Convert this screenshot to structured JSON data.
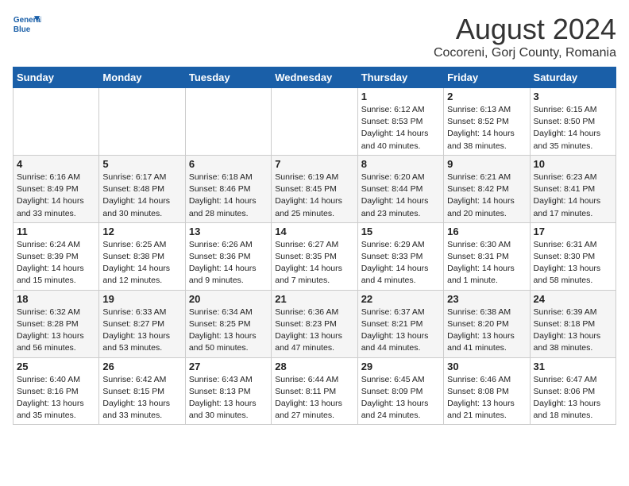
{
  "header": {
    "logo_line1": "General",
    "logo_line2": "Blue",
    "month_year": "August 2024",
    "location": "Cocoreni, Gorj County, Romania"
  },
  "weekdays": [
    "Sunday",
    "Monday",
    "Tuesday",
    "Wednesday",
    "Thursday",
    "Friday",
    "Saturday"
  ],
  "weeks": [
    [
      {
        "day": "",
        "info": ""
      },
      {
        "day": "",
        "info": ""
      },
      {
        "day": "",
        "info": ""
      },
      {
        "day": "",
        "info": ""
      },
      {
        "day": "1",
        "info": "Sunrise: 6:12 AM\nSunset: 8:53 PM\nDaylight: 14 hours\nand 40 minutes."
      },
      {
        "day": "2",
        "info": "Sunrise: 6:13 AM\nSunset: 8:52 PM\nDaylight: 14 hours\nand 38 minutes."
      },
      {
        "day": "3",
        "info": "Sunrise: 6:15 AM\nSunset: 8:50 PM\nDaylight: 14 hours\nand 35 minutes."
      }
    ],
    [
      {
        "day": "4",
        "info": "Sunrise: 6:16 AM\nSunset: 8:49 PM\nDaylight: 14 hours\nand 33 minutes."
      },
      {
        "day": "5",
        "info": "Sunrise: 6:17 AM\nSunset: 8:48 PM\nDaylight: 14 hours\nand 30 minutes."
      },
      {
        "day": "6",
        "info": "Sunrise: 6:18 AM\nSunset: 8:46 PM\nDaylight: 14 hours\nand 28 minutes."
      },
      {
        "day": "7",
        "info": "Sunrise: 6:19 AM\nSunset: 8:45 PM\nDaylight: 14 hours\nand 25 minutes."
      },
      {
        "day": "8",
        "info": "Sunrise: 6:20 AM\nSunset: 8:44 PM\nDaylight: 14 hours\nand 23 minutes."
      },
      {
        "day": "9",
        "info": "Sunrise: 6:21 AM\nSunset: 8:42 PM\nDaylight: 14 hours\nand 20 minutes."
      },
      {
        "day": "10",
        "info": "Sunrise: 6:23 AM\nSunset: 8:41 PM\nDaylight: 14 hours\nand 17 minutes."
      }
    ],
    [
      {
        "day": "11",
        "info": "Sunrise: 6:24 AM\nSunset: 8:39 PM\nDaylight: 14 hours\nand 15 minutes."
      },
      {
        "day": "12",
        "info": "Sunrise: 6:25 AM\nSunset: 8:38 PM\nDaylight: 14 hours\nand 12 minutes."
      },
      {
        "day": "13",
        "info": "Sunrise: 6:26 AM\nSunset: 8:36 PM\nDaylight: 14 hours\nand 9 minutes."
      },
      {
        "day": "14",
        "info": "Sunrise: 6:27 AM\nSunset: 8:35 PM\nDaylight: 14 hours\nand 7 minutes."
      },
      {
        "day": "15",
        "info": "Sunrise: 6:29 AM\nSunset: 8:33 PM\nDaylight: 14 hours\nand 4 minutes."
      },
      {
        "day": "16",
        "info": "Sunrise: 6:30 AM\nSunset: 8:31 PM\nDaylight: 14 hours\nand 1 minute."
      },
      {
        "day": "17",
        "info": "Sunrise: 6:31 AM\nSunset: 8:30 PM\nDaylight: 13 hours\nand 58 minutes."
      }
    ],
    [
      {
        "day": "18",
        "info": "Sunrise: 6:32 AM\nSunset: 8:28 PM\nDaylight: 13 hours\nand 56 minutes."
      },
      {
        "day": "19",
        "info": "Sunrise: 6:33 AM\nSunset: 8:27 PM\nDaylight: 13 hours\nand 53 minutes."
      },
      {
        "day": "20",
        "info": "Sunrise: 6:34 AM\nSunset: 8:25 PM\nDaylight: 13 hours\nand 50 minutes."
      },
      {
        "day": "21",
        "info": "Sunrise: 6:36 AM\nSunset: 8:23 PM\nDaylight: 13 hours\nand 47 minutes."
      },
      {
        "day": "22",
        "info": "Sunrise: 6:37 AM\nSunset: 8:21 PM\nDaylight: 13 hours\nand 44 minutes."
      },
      {
        "day": "23",
        "info": "Sunrise: 6:38 AM\nSunset: 8:20 PM\nDaylight: 13 hours\nand 41 minutes."
      },
      {
        "day": "24",
        "info": "Sunrise: 6:39 AM\nSunset: 8:18 PM\nDaylight: 13 hours\nand 38 minutes."
      }
    ],
    [
      {
        "day": "25",
        "info": "Sunrise: 6:40 AM\nSunset: 8:16 PM\nDaylight: 13 hours\nand 35 minutes."
      },
      {
        "day": "26",
        "info": "Sunrise: 6:42 AM\nSunset: 8:15 PM\nDaylight: 13 hours\nand 33 minutes."
      },
      {
        "day": "27",
        "info": "Sunrise: 6:43 AM\nSunset: 8:13 PM\nDaylight: 13 hours\nand 30 minutes."
      },
      {
        "day": "28",
        "info": "Sunrise: 6:44 AM\nSunset: 8:11 PM\nDaylight: 13 hours\nand 27 minutes."
      },
      {
        "day": "29",
        "info": "Sunrise: 6:45 AM\nSunset: 8:09 PM\nDaylight: 13 hours\nand 24 minutes."
      },
      {
        "day": "30",
        "info": "Sunrise: 6:46 AM\nSunset: 8:08 PM\nDaylight: 13 hours\nand 21 minutes."
      },
      {
        "day": "31",
        "info": "Sunrise: 6:47 AM\nSunset: 8:06 PM\nDaylight: 13 hours\nand 18 minutes."
      }
    ]
  ]
}
